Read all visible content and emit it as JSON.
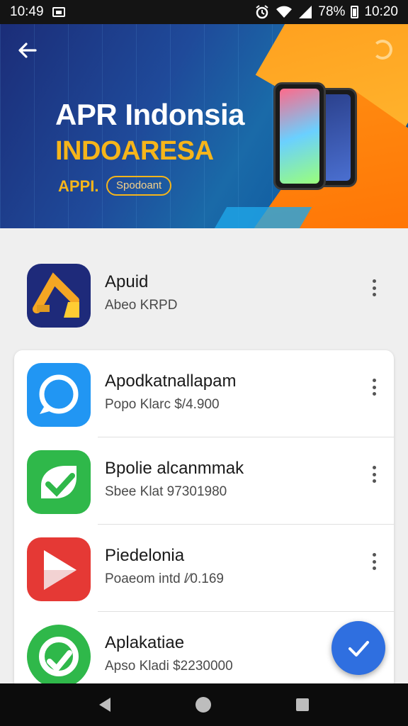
{
  "status_bar": {
    "time_left": "10:49",
    "battery": "78%",
    "time_right": "10:20"
  },
  "banner": {
    "title": "APR Indonsia",
    "subtitle": "INDOARESA",
    "api_label": "APPI.",
    "pill_label": "Spodoant"
  },
  "featured_app": {
    "name": "Apuid",
    "subtitle": "Abeo KRPD"
  },
  "apps": [
    {
      "name": "Apodkatnallapam",
      "subtitle": "Popo Klarc $/4.900",
      "icon_color": "#2196f3"
    },
    {
      "name": "Bpolie alcanmmak",
      "subtitle": "Sbee Klat 97301980",
      "icon_color": "#2fb84a"
    },
    {
      "name": "Piedelonia",
      "subtitle": "Poaeom intd /⁄0.169",
      "icon_color": "#e53935"
    },
    {
      "name": "Aplakatiae",
      "subtitle": "Apso Kladi $2230000",
      "icon_color": "#2fb84a"
    }
  ],
  "icons": [
    "back-arrow-icon",
    "refresh-icon",
    "more-vert-icon",
    "check-icon",
    "wifi-icon",
    "signal-icon",
    "battery-icon",
    "alarm-icon"
  ]
}
